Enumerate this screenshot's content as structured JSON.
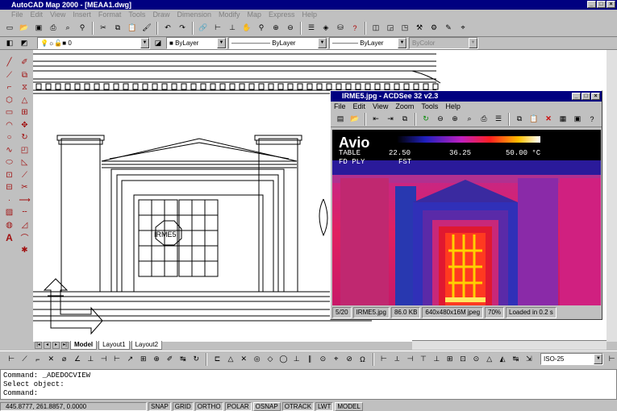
{
  "app": {
    "title": "AutoCAD Map 2000 - [MEAA1.dwg]"
  },
  "menu": [
    "File",
    "Edit",
    "View",
    "Insert",
    "Format",
    "Tools",
    "Draw",
    "Dimension",
    "Modify",
    "Map",
    "Express",
    "Help"
  ],
  "layer_toolbar": {
    "layer_name": "0",
    "color": "ByLayer",
    "linetype": "ByLayer",
    "lineweight": "ByLayer",
    "plotstyle": "ByColor"
  },
  "drawing": {
    "block_label": "IRME5"
  },
  "tabs": [
    "Model",
    "Layout1",
    "Layout2"
  ],
  "dim_style": "ISO-25",
  "command_lines": [
    "Command:  _ADEDOCVIEW",
    "Select object:",
    "Command:"
  ],
  "status": {
    "coords": "445.8777, 261.8857, 0.0000",
    "buttons": [
      "SNAP",
      "GRID",
      "ORTHO",
      "POLAR",
      "OSNAP",
      "OTRACK",
      "LWT",
      "MODEL"
    ]
  },
  "acdsee": {
    "title": "IRME5.jpg - ACDSee 32 v2.3",
    "menu": [
      "File",
      "Edit",
      "View",
      "Zoom",
      "Tools",
      "Help"
    ],
    "image_text": {
      "brand": "Avio",
      "table": "TABLE",
      "t_min": "22.50",
      "t_mid": "36.25",
      "t_max": "50.00 °C",
      "mode": "FD PLY",
      "mode2": "FST"
    },
    "status": [
      "5/20",
      "IRME5.jpg",
      "86.0 KB",
      "640x480x16M jpeg",
      "70%",
      "Loaded in 0.2 s"
    ]
  }
}
